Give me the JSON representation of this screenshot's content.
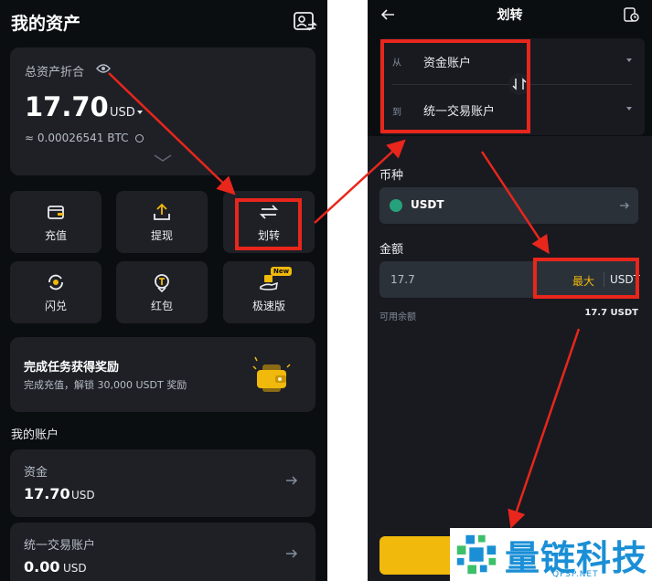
{
  "left": {
    "header": {
      "title": "我的资产",
      "icon": "contacts-swap-icon"
    },
    "asset_card": {
      "label": "总资产折合",
      "value": "17.70",
      "unit": "USD",
      "btc": "≈ 0.00026541 BTC"
    },
    "tiles": [
      {
        "label": "充值",
        "icon": "deposit-icon"
      },
      {
        "label": "提现",
        "icon": "withdraw-icon"
      },
      {
        "label": "划转",
        "icon": "transfer-icon"
      },
      {
        "label": "闪兑",
        "icon": "convert-icon"
      },
      {
        "label": "红包",
        "icon": "red-packet-icon"
      },
      {
        "label": "极速版",
        "icon": "lite-icon",
        "badge": "New"
      }
    ],
    "task_card": {
      "title": "完成任务获得奖励",
      "subtitle": "完成充值，解锁 30,000 USDT 奖励"
    },
    "accounts_title": "我的账户",
    "accounts": [
      {
        "name": "资金",
        "value": "17.70",
        "unit": "USD"
      },
      {
        "name": "统一交易账户",
        "value": "0.00",
        "unit": "USD"
      }
    ]
  },
  "right": {
    "header": {
      "title": "划转"
    },
    "from": {
      "label": "从",
      "value": "资金账户"
    },
    "to": {
      "label": "到",
      "value": "统一交易账户"
    },
    "coin_label": "币种",
    "coin": "USDT",
    "amount_label": "金额",
    "amount_value": "17.7",
    "max_label": "最大",
    "amount_unit": "USDT",
    "available_label": "可用余额",
    "available_value": "17.7 USDT"
  },
  "watermark": {
    "text": "量链科技",
    "sub": "QFSP.NET"
  },
  "colors": {
    "accent": "#f0b90b",
    "annotation": "#e8261c",
    "watermark": "#1a8fd6",
    "usdt": "#26a17b"
  }
}
